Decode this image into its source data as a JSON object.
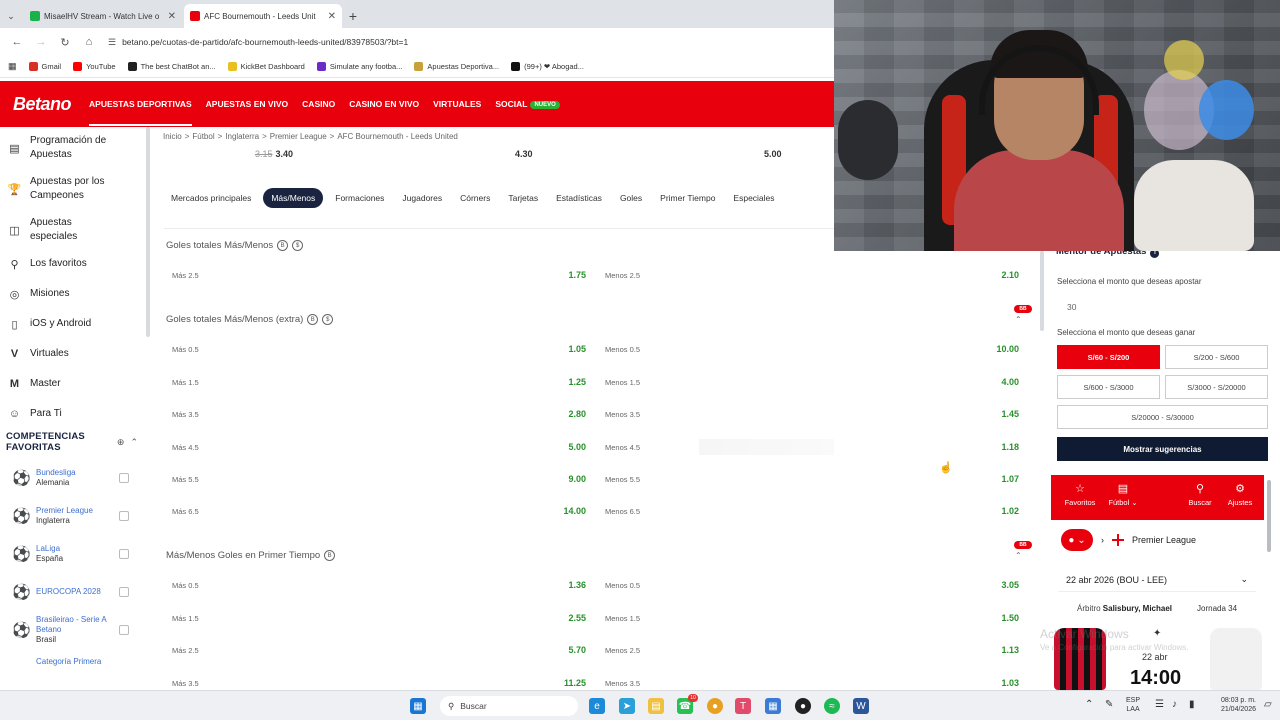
{
  "browser": {
    "tabs": [
      {
        "title": "MisaelHV Stream - Watch Live o",
        "active": false
      },
      {
        "title": "AFC Bournemouth - Leeds Unit",
        "active": true
      }
    ],
    "url": "betano.pe/cuotas-de-partido/afc-bournemouth-leeds-united/83978503/?bt=1",
    "bookmarks": [
      "Gmail",
      "YouTube",
      "The best ChatBot an...",
      "KickBet Dashboard",
      "Simulate any footba...",
      "Apuestas Deportiva...",
      "(99+) ❤ Abogad..."
    ]
  },
  "header": {
    "logo": "Betano",
    "nav": [
      "APUESTAS DEPORTIVAS",
      "APUESTAS EN VIVO",
      "CASINO",
      "CASINO EN VIVO",
      "VIRTUALES",
      "SOCIAL"
    ],
    "badge_new": "NUEVO"
  },
  "sidebar": {
    "items": [
      {
        "label": "Programación de Apuestas",
        "icon": "schedule-icon"
      },
      {
        "label": "Apuestas por los Campeones",
        "icon": "trophy-icon"
      },
      {
        "label": "Apuestas especiales",
        "icon": "special-bets-icon"
      },
      {
        "label": "Los favoritos",
        "icon": "pin-icon"
      },
      {
        "label": "Misiones",
        "icon": "target-icon"
      },
      {
        "label": "iOS y Android",
        "icon": "mobile-icon"
      },
      {
        "label": "Virtuales",
        "icon": "virtual-icon"
      },
      {
        "label": "Master",
        "icon": "master-icon"
      },
      {
        "label": "Para Ti",
        "icon": "user-icon"
      }
    ],
    "competitions_title": "COMPETENCIAS FAVORITAS",
    "competitions": [
      {
        "name": "Bundesliga",
        "country": "Alemania"
      },
      {
        "name": "Premier League",
        "country": "Inglaterra"
      },
      {
        "name": "LaLiga",
        "country": "España"
      },
      {
        "name": "EUROCOPA 2028",
        "country": ""
      },
      {
        "name": "Brasileirao - Serie A Betano",
        "country": "Brasil"
      },
      {
        "name": "Categoría Primera",
        "country": ""
      }
    ]
  },
  "main": {
    "breadcrumb": [
      "Inicio",
      "Fútbol",
      "Inglaterra",
      "Premier League",
      "AFC Bournemouth - Leeds United"
    ],
    "top_odds": {
      "old": "3.15",
      "home": "3.40",
      "draw": "4.30",
      "away": "5.00"
    },
    "market_tabs": [
      "Mercados principales",
      "Más/Menos",
      "Formaciones",
      "Jugadores",
      "Córners",
      "Tarjetas",
      "Estadísticas",
      "Goles",
      "Primer Tiempo",
      "Especiales"
    ],
    "active_tab": "Más/Menos",
    "sections": [
      {
        "title": "Goles totales Más/Menos",
        "rows": [
          {
            "l1": "Más 2.5",
            "o1": "1.75",
            "l2": "Menos 2.5",
            "o2": "2.10"
          }
        ]
      },
      {
        "title": "Goles totales Más/Menos (extra)",
        "rows": [
          {
            "l1": "Más 0.5",
            "o1": "1.05",
            "l2": "Menos 0.5",
            "o2": "10.00"
          },
          {
            "l1": "Más 1.5",
            "o1": "1.25",
            "l2": "Menos 1.5",
            "o2": "4.00"
          },
          {
            "l1": "Más 3.5",
            "o1": "2.80",
            "l2": "Menos 3.5",
            "o2": "1.45"
          },
          {
            "l1": "Más 4.5",
            "o1": "5.00",
            "l2": "Menos 4.5",
            "o2": "1.18"
          },
          {
            "l1": "Más 5.5",
            "o1": "9.00",
            "l2": "Menos 5.5",
            "o2": "1.07"
          },
          {
            "l1": "Más 6.5",
            "o1": "14.00",
            "l2": "Menos 6.5",
            "o2": "1.02"
          }
        ]
      },
      {
        "title": "Más/Menos Goles en Primer Tiempo",
        "rows": [
          {
            "l1": "Más 0.5",
            "o1": "1.36",
            "l2": "Menos 0.5",
            "o2": "3.05"
          },
          {
            "l1": "Más 1.5",
            "o1": "2.55",
            "l2": "Menos 1.5",
            "o2": "1.50"
          },
          {
            "l1": "Más 2.5",
            "o1": "5.70",
            "l2": "Menos 2.5",
            "o2": "1.13"
          },
          {
            "l1": "Más 3.5",
            "o1": "11.25",
            "l2": "Menos 3.5",
            "o2": "1.03"
          }
        ]
      }
    ],
    "bb_badge": "BB"
  },
  "mentor": {
    "title": "Mentor de Apuestas",
    "bet_label": "Selecciona el monto que deseas apostar",
    "bet_value": "30",
    "win_label": "Selecciona el monto que deseas ganar",
    "ranges": [
      "S/60 - S/200",
      "S/200 - S/600",
      "S/600 - S/3000",
      "S/3000 - S/20000",
      "S/20000 - S/30000"
    ],
    "suggest_button": "Mostrar sugerencias"
  },
  "bottom_nav": {
    "favoritos": "Favoritos",
    "futbol": "Fútbol",
    "buscar": "Buscar",
    "ajustes": "Ajustes"
  },
  "match_info": {
    "league": "Premier League",
    "date_select": "22 abr 2026 (BOU - LEE)",
    "referee_label": "Árbitro",
    "referee": "Salisbury, Michael",
    "round": "Jornada 34",
    "date": "22 abr",
    "time": "14:00",
    "watermark": "Activar Windows",
    "watermark_sub": "Ve a Configuración para activar Windows."
  },
  "taskbar": {
    "search": "Buscar",
    "lang": "ESP",
    "lang2": "LAA",
    "clock_time": "08:03 p. m.",
    "clock_date": "21/04/2026",
    "whatsapp_badge": "10"
  }
}
